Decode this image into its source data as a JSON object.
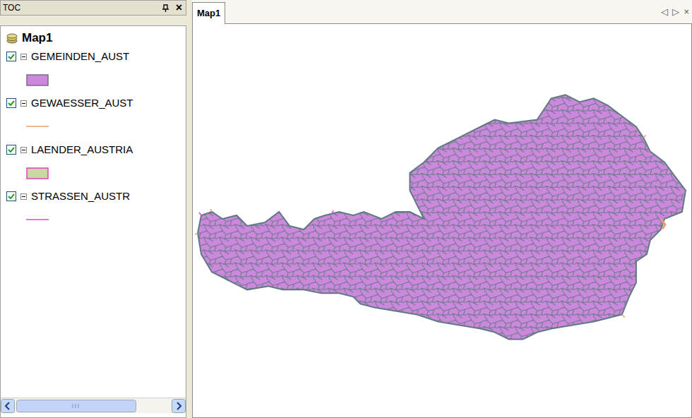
{
  "toc": {
    "title": "TOC",
    "close": "×",
    "map_label": "Map1",
    "layers": [
      {
        "name": "GEMEINDEN_AUST",
        "checked": true,
        "expanded": true,
        "kind": "polygon",
        "color": "#cc88dd",
        "outline": "#7a6a88"
      },
      {
        "name": "GEWAESSER_AUST",
        "checked": true,
        "expanded": true,
        "kind": "line",
        "color": "#e8a070"
      },
      {
        "name": "LAENDER_AUSTRIA",
        "checked": true,
        "expanded": true,
        "kind": "polygon",
        "color": "#c8d8a0",
        "outline": "#e040c0"
      },
      {
        "name": "STRASSEN_AUSTR",
        "checked": true,
        "expanded": true,
        "kind": "line",
        "color": "#e040e0"
      }
    ]
  },
  "document": {
    "tabs": [
      {
        "label": "Map1",
        "selected": true
      }
    ],
    "nav": [
      "◁",
      "▷",
      "×"
    ]
  }
}
